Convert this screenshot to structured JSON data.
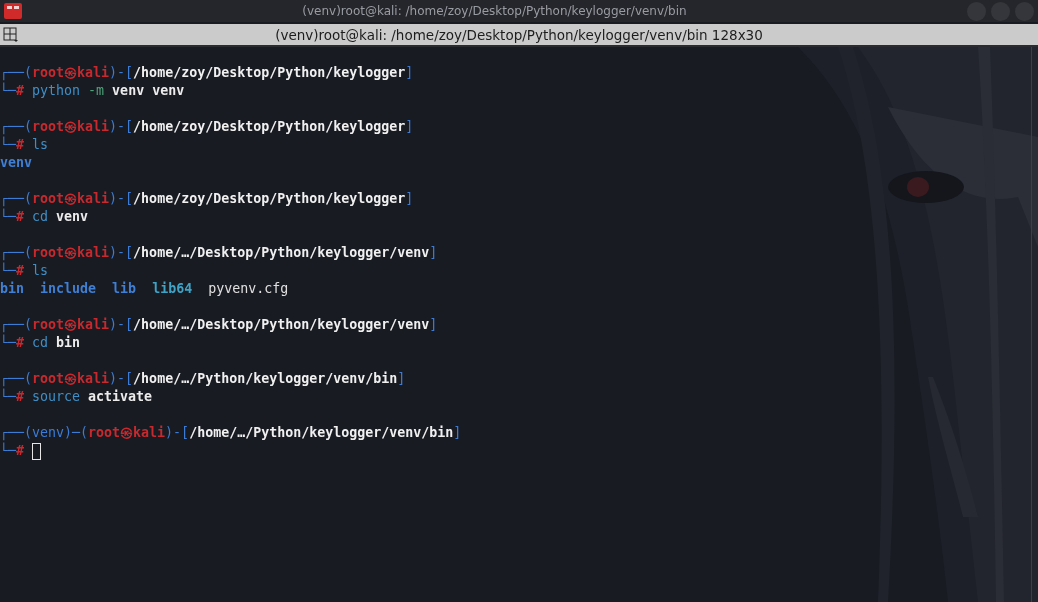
{
  "window": {
    "title": "(venv)root@kali: /home/zoy/Desktop/Python/keylogger/venv/bin"
  },
  "tab_bar": {
    "title": "(venv)root@kali: /home/zoy/Desktop/Python/keylogger/venv/bin 128x30"
  },
  "terminal": {
    "entries": [
      {
        "prompt": [
          {
            "text": "┌──(",
            "kind": "frame"
          },
          {
            "text": "root㉿kali",
            "kind": "user"
          },
          {
            "text": ")-[",
            "kind": "frame"
          },
          {
            "text": "/home/zoy/Desktop/Python/keylogger",
            "kind": "path"
          },
          {
            "text": "]",
            "kind": "frame"
          }
        ],
        "command": [
          {
            "text": "└─",
            "kind": "frame"
          },
          {
            "text": "#",
            "kind": "sign"
          },
          {
            "text": " python",
            "kind": "cmd"
          },
          {
            "text": " -m",
            "kind": "flag"
          },
          {
            "text": " venv venv",
            "kind": "arg"
          }
        ],
        "cursor": false
      },
      {
        "prompt": [
          {
            "text": "┌──(",
            "kind": "frame"
          },
          {
            "text": "root㉿kali",
            "kind": "user"
          },
          {
            "text": ")-[",
            "kind": "frame"
          },
          {
            "text": "/home/zoy/Desktop/Python/keylogger",
            "kind": "path"
          },
          {
            "text": "]",
            "kind": "frame"
          }
        ],
        "command": [
          {
            "text": "└─",
            "kind": "frame"
          },
          {
            "text": "#",
            "kind": "sign"
          },
          {
            "text": " ls",
            "kind": "cmd"
          }
        ],
        "cursor": false,
        "output": [
          {
            "text": "venv",
            "kind": "dir"
          }
        ]
      },
      {
        "prompt": [
          {
            "text": "┌──(",
            "kind": "frame"
          },
          {
            "text": "root㉿kali",
            "kind": "user"
          },
          {
            "text": ")-[",
            "kind": "frame"
          },
          {
            "text": "/home/zoy/Desktop/Python/keylogger",
            "kind": "path"
          },
          {
            "text": "]",
            "kind": "frame"
          }
        ],
        "command": [
          {
            "text": "└─",
            "kind": "frame"
          },
          {
            "text": "#",
            "kind": "sign"
          },
          {
            "text": " cd",
            "kind": "cmd"
          },
          {
            "text": " venv",
            "kind": "arg"
          }
        ],
        "cursor": false
      },
      {
        "prompt": [
          {
            "text": "┌──(",
            "kind": "frame"
          },
          {
            "text": "root㉿kali",
            "kind": "user"
          },
          {
            "text": ")-[",
            "kind": "frame"
          },
          {
            "text": "/home/…/Desktop/Python/keylogger/venv",
            "kind": "path"
          },
          {
            "text": "]",
            "kind": "frame"
          }
        ],
        "command": [
          {
            "text": "└─",
            "kind": "frame"
          },
          {
            "text": "#",
            "kind": "sign"
          },
          {
            "text": " ls",
            "kind": "cmd"
          }
        ],
        "cursor": false,
        "output": [
          {
            "text": "bin",
            "kind": "dir"
          },
          {
            "text": "  include",
            "kind": "dir"
          },
          {
            "text": "  lib",
            "kind": "dir"
          },
          {
            "text": "  lib64",
            "kind": "link"
          },
          {
            "text": "  pyvenv.cfg",
            "kind": "file"
          }
        ]
      },
      {
        "prompt": [
          {
            "text": "┌──(",
            "kind": "frame"
          },
          {
            "text": "root㉿kali",
            "kind": "user"
          },
          {
            "text": ")-[",
            "kind": "frame"
          },
          {
            "text": "/home/…/Desktop/Python/keylogger/venv",
            "kind": "path"
          },
          {
            "text": "]",
            "kind": "frame"
          }
        ],
        "command": [
          {
            "text": "└─",
            "kind": "frame"
          },
          {
            "text": "#",
            "kind": "sign"
          },
          {
            "text": " cd",
            "kind": "cmd"
          },
          {
            "text": " bin",
            "kind": "arg"
          }
        ],
        "cursor": false
      },
      {
        "prompt": [
          {
            "text": "┌──(",
            "kind": "frame"
          },
          {
            "text": "root㉿kali",
            "kind": "user"
          },
          {
            "text": ")-[",
            "kind": "frame"
          },
          {
            "text": "/home/…/Python/keylogger/venv/bin",
            "kind": "path"
          },
          {
            "text": "]",
            "kind": "frame"
          }
        ],
        "command": [
          {
            "text": "└─",
            "kind": "frame"
          },
          {
            "text": "#",
            "kind": "sign"
          },
          {
            "text": " source",
            "kind": "cmd"
          },
          {
            "text": " activate",
            "kind": "arg"
          }
        ],
        "cursor": false
      },
      {
        "prompt": [
          {
            "text": "┌──(venv)─(",
            "kind": "frame"
          },
          {
            "text": "root㉿kali",
            "kind": "user"
          },
          {
            "text": ")-[",
            "kind": "frame"
          },
          {
            "text": "/home/…/Python/keylogger/venv/bin",
            "kind": "path"
          },
          {
            "text": "]",
            "kind": "frame"
          }
        ],
        "command": [
          {
            "text": "└─",
            "kind": "frame"
          },
          {
            "text": "#",
            "kind": "sign"
          }
        ],
        "cursor": true
      }
    ]
  }
}
